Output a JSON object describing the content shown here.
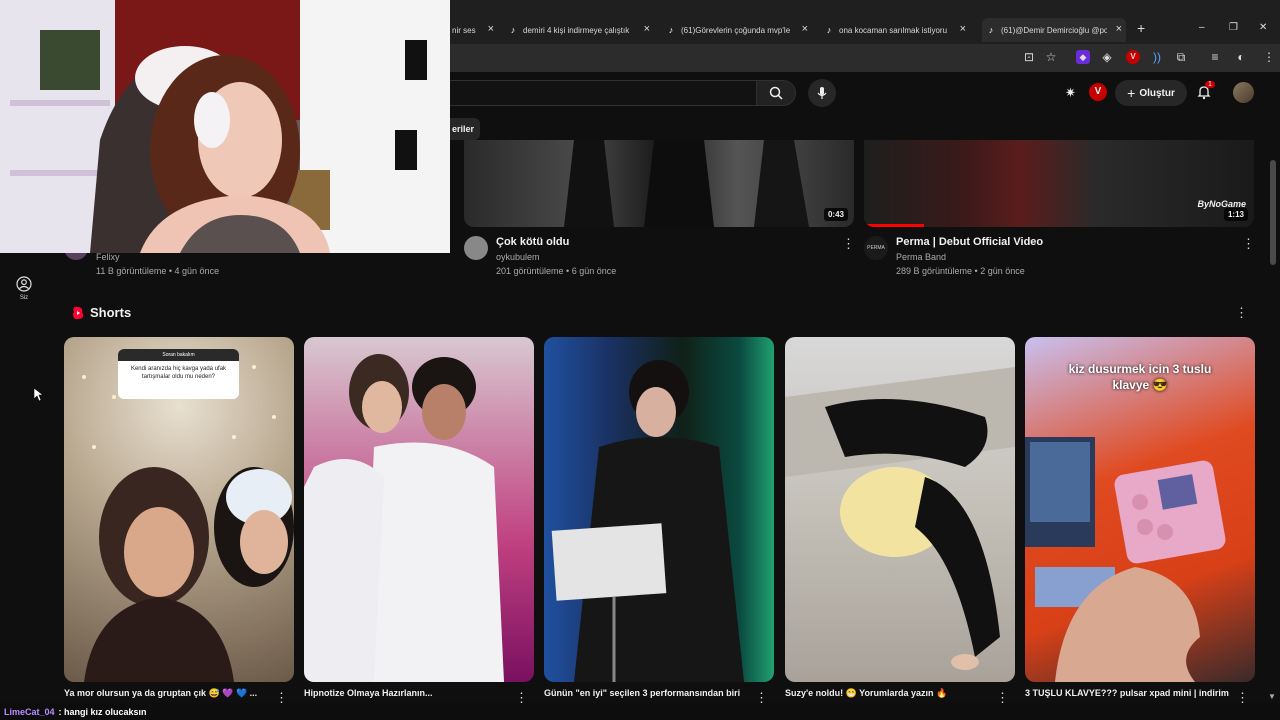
{
  "browser": {
    "tabs": [
      {
        "label": "nir ses"
      },
      {
        "label": "demiri 4 kişi indirmeye çalıştık"
      },
      {
        "label": "(61)Görevlerin çoğunda mvp'le"
      },
      {
        "label": "ona kocaman sarılmak istiyoru"
      },
      {
        "label": "(61)@Demir Demircioğlu @pop"
      }
    ],
    "new_tab": "+",
    "window_controls": {
      "minimize": "–",
      "maximize": "❐",
      "close": "✕"
    }
  },
  "header": {
    "create_label": "Oluştur",
    "notification_count": "1",
    "chip_label": "eriler"
  },
  "sidebar": {
    "you_label": "Siz"
  },
  "videos": [
    {
      "title": "",
      "channel": "Felixy",
      "meta": "11 B görüntüleme • 4 gün önce"
    },
    {
      "title": "Çok kötü oldu",
      "channel": "oykubulem",
      "meta": "201 görüntüleme • 6 gün önce",
      "duration": "0:43"
    },
    {
      "title": "Perma | Debut Official Video",
      "channel": "Perma Band",
      "meta": "289 B görüntüleme • 2 gün önce",
      "duration": "1:13",
      "watermark": "ByNoGame",
      "avatar_text": "PERMA"
    }
  ],
  "shorts": {
    "section_title": "Shorts",
    "items": [
      {
        "title": "Ya mor olursun ya da gruptan çık 😅 💜 💙 ...",
        "overlay_heading": "Soran bakalım",
        "overlay_text": "Kendi aranızda hiç kavga yada ufak tartışmalar oldu mu neden?"
      },
      {
        "title": "Hipnotize Olmaya Hazırlanın..."
      },
      {
        "title": "Günün \"en iyi\" seçilen 3 performansından biri"
      },
      {
        "title": "Suzy'e noldu! 😁 Yorumlarda yazın 🔥"
      },
      {
        "title": "3 TUŞLU KLAVYE??? pulsar xpad mini | indirim",
        "overlay_text": "kiz dusurmek icin 3 tuslu klavye 😎"
      }
    ]
  },
  "chat": {
    "user": "LimeCat_04",
    "message": ": hangi kız olucaksın"
  },
  "colors": {
    "bg": "#0f0f0f",
    "shorts_red": "#ff0033",
    "chat_user": "#b98cff"
  }
}
